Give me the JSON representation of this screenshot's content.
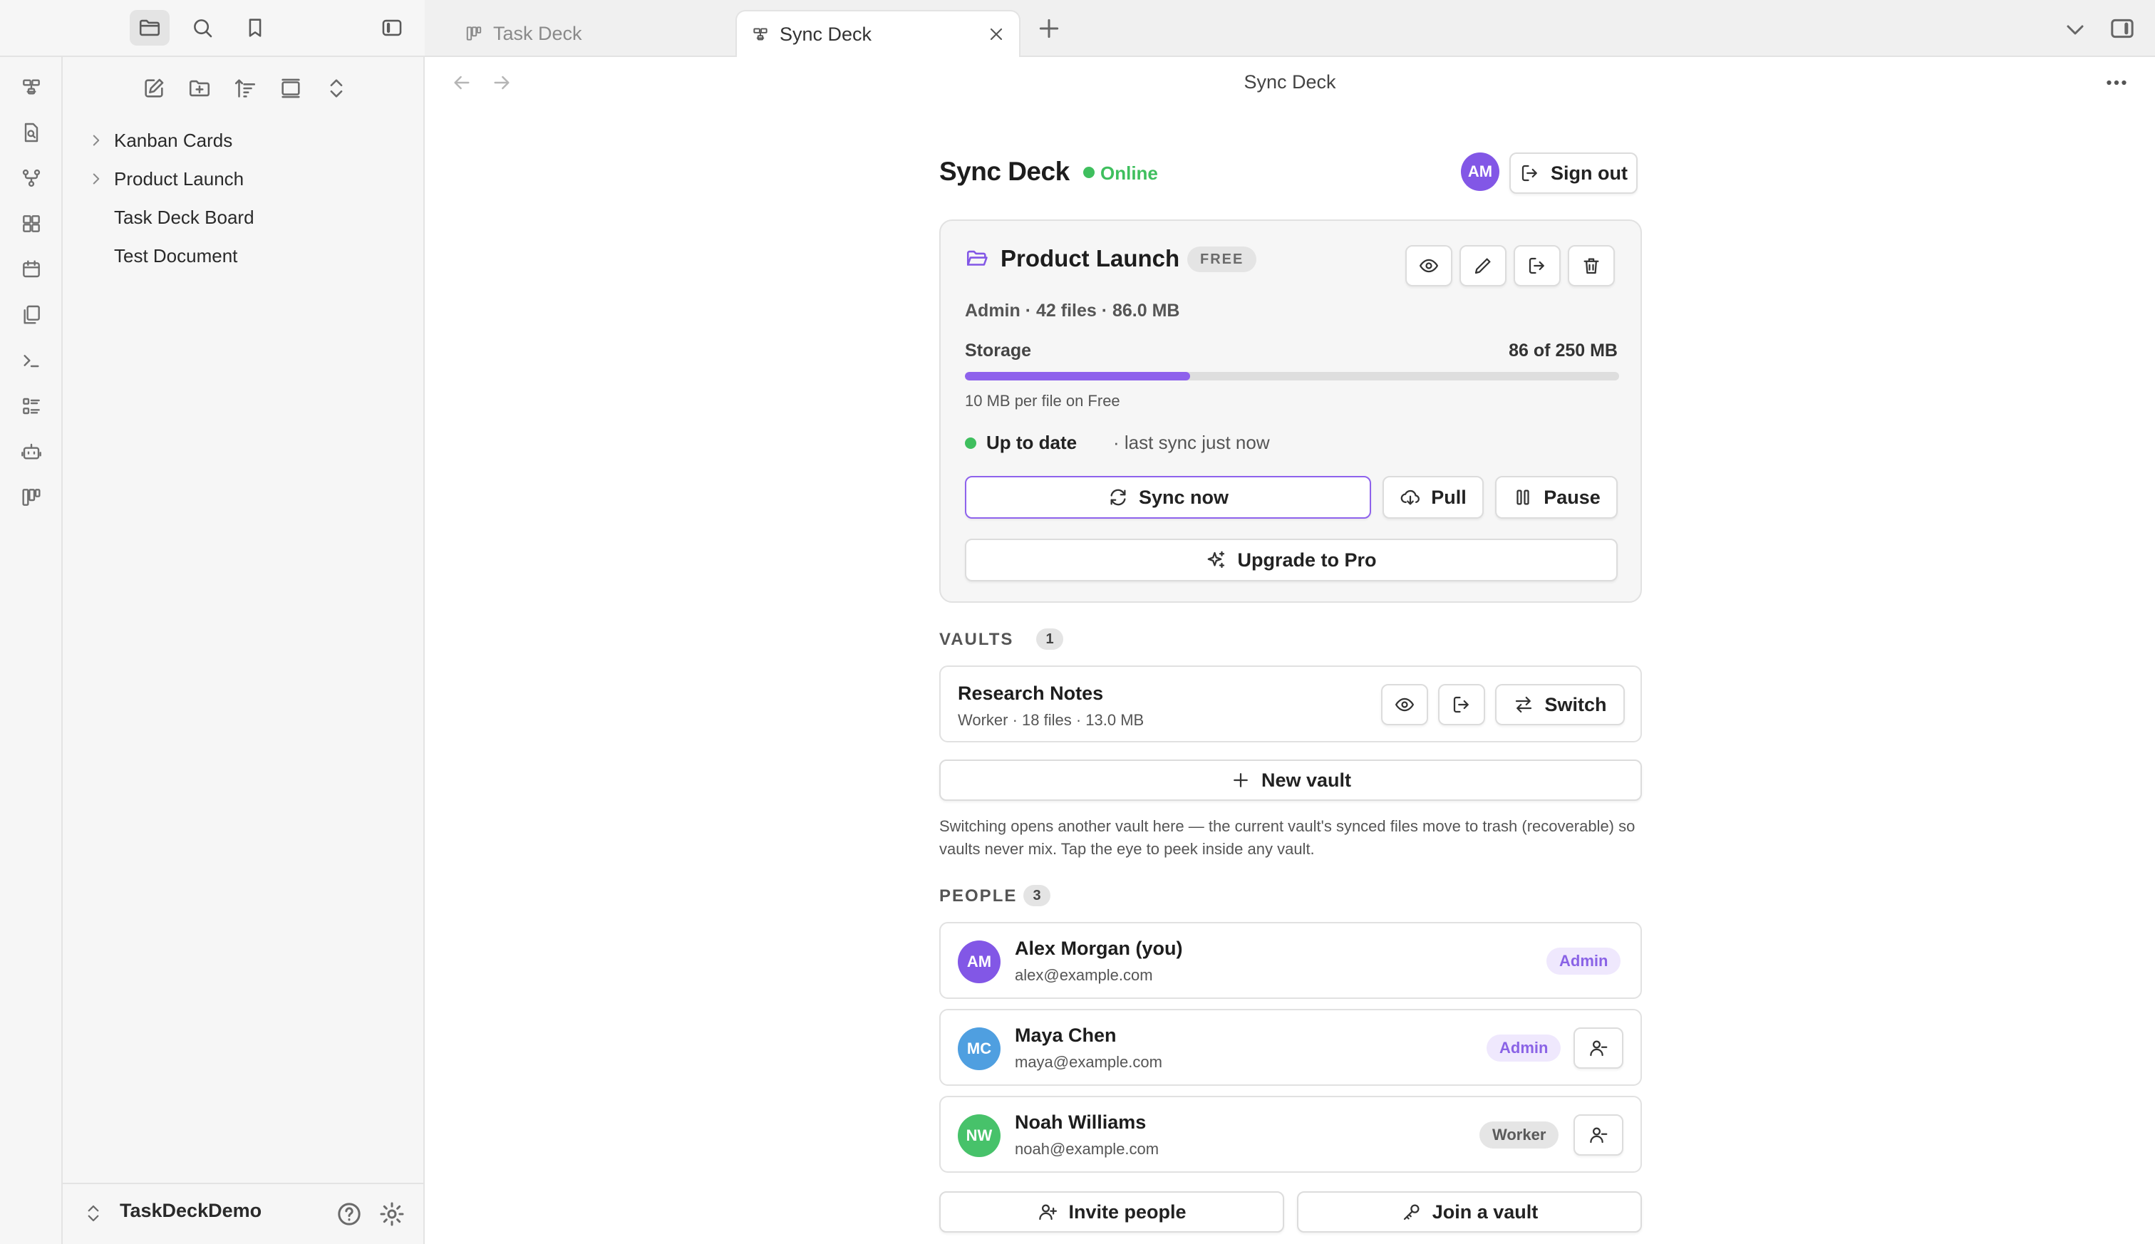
{
  "window": {
    "tabs": [
      {
        "label": "Task Deck",
        "icon": "kanban-icon",
        "active": false
      },
      {
        "label": "Sync Deck",
        "icon": "sync-deck-icon",
        "active": true
      }
    ]
  },
  "nav": {
    "title": "Sync Deck"
  },
  "sidebar": {
    "tree": [
      {
        "label": "Kanban Cards",
        "folder": true
      },
      {
        "label": "Product Launch",
        "folder": true
      },
      {
        "label": "Task Deck Board",
        "folder": false
      },
      {
        "label": "Test Document",
        "folder": false
      }
    ],
    "vault_name": "TaskDeckDemo"
  },
  "header": {
    "title": "Sync Deck",
    "status": "Online",
    "avatar_initials": "AM",
    "sign_out_label": "Sign out"
  },
  "current_vault": {
    "name": "Product Launch",
    "plan": "FREE",
    "meta": "Admin · 42 files · 86.0 MB",
    "storage_label": "Storage",
    "storage_value": "86 of 250 MB",
    "storage_used_fraction": 0.344,
    "limit_note": "10 MB per file on Free",
    "sync_state": "Up to date",
    "sync_time": "· last sync just now",
    "sync_now_label": "Sync now",
    "pull_label": "Pull",
    "pause_label": "Pause",
    "upgrade_label": "Upgrade to Pro"
  },
  "vaults": {
    "title": "VAULTS",
    "count": "1",
    "items": [
      {
        "name": "Research Notes",
        "meta": "Worker · 18 files · 13.0 MB",
        "switch_label": "Switch"
      }
    ],
    "new_vault_label": "New vault",
    "note": "Switching opens another vault here — the current vault's synced files move to trash (recoverable) so vaults never mix. Tap the eye to peek inside any vault."
  },
  "people": {
    "title": "PEOPLE",
    "count": "3",
    "items": [
      {
        "initials": "AM",
        "name": "Alex Morgan (you)",
        "email": "alex@example.com",
        "role": "Admin",
        "color": "#8257e6"
      },
      {
        "initials": "MC",
        "name": "Maya Chen",
        "email": "maya@example.com",
        "role": "Admin",
        "color": "#4f9fe0"
      },
      {
        "initials": "NW",
        "name": "Noah Williams",
        "email": "noah@example.com",
        "role": "Worker",
        "color": "#47c26a"
      }
    ],
    "invite_label": "Invite people",
    "join_label": "Join a vault"
  },
  "colors": {
    "accent": "#8e62ec",
    "online": "#3fbf5e"
  }
}
